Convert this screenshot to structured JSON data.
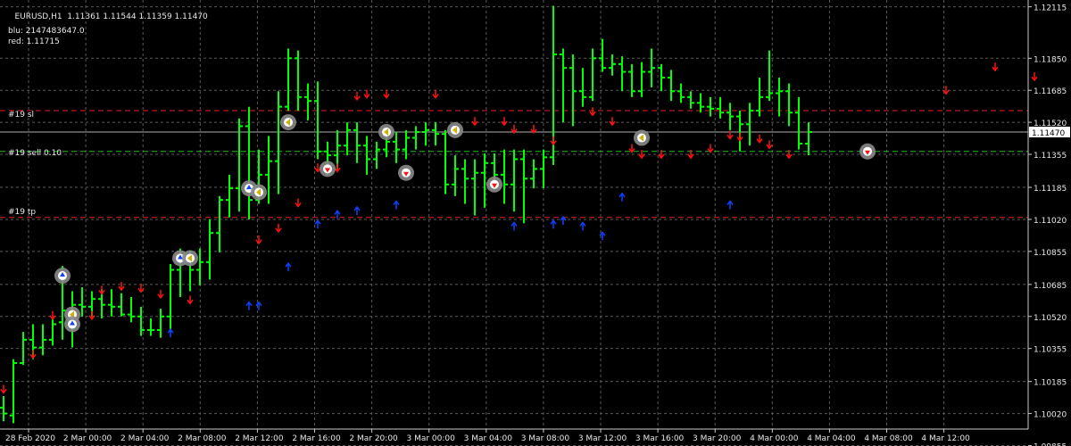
{
  "header": {
    "symbol": "EURUSD,H1",
    "ohlc": "1.11361 1.11544 1.11359 1.11470"
  },
  "indicator": {
    "blu": "blu: 2147483647.0",
    "red": "red: 1.11715"
  },
  "levels": {
    "sl": {
      "label": "#19 sl",
      "price": 1.1158,
      "color": "#e02020"
    },
    "sell": {
      "label": "#19 sell 0.10",
      "price": 1.1137,
      "color": "#20c020"
    },
    "tp": {
      "label": "#19 tp",
      "price": 1.1103,
      "color": "#e02020"
    }
  },
  "current_price": {
    "label": "1.11470",
    "value": 1.1147
  },
  "colors": {
    "background": "#000000",
    "grid": "#5a5a5a",
    "bar": "#00ff00",
    "up_arrow": "#1040ff",
    "down_arrow": "#ff1010",
    "text": "#e8e8e8"
  },
  "chart_data": {
    "type": "ohlc",
    "ylim": [
      1.0994,
      1.1215
    ],
    "grid": true,
    "y_ticks": [
      "1.12115",
      "1.11850",
      "1.11685",
      "1.11520",
      "1.11355",
      "1.11185",
      "1.11020",
      "1.10855",
      "1.10685",
      "1.10520",
      "1.10355",
      "1.10185",
      "1.10020",
      "1.09855"
    ],
    "y_tick_values": [
      1.12115,
      1.1185,
      1.11685,
      1.1152,
      1.11355,
      1.11185,
      1.1102,
      1.10855,
      1.10685,
      1.1052,
      1.10355,
      1.10185,
      1.1002,
      1.09855
    ],
    "x_ticks": [
      "28 Feb 2020",
      "2 Mar 00:00",
      "2 Mar 04:00",
      "2 Mar 08:00",
      "2 Mar 12:00",
      "2 Mar 16:00",
      "2 Mar 20:00",
      "3 Mar 00:00",
      "3 Mar 04:00",
      "3 Mar 08:00",
      "3 Mar 12:00",
      "3 Mar 16:00",
      "3 Mar 20:00",
      "4 Mar 00:00",
      "4 Mar 04:00",
      "4 Mar 08:00",
      "4 Mar 12:00"
    ],
    "bars": [
      [
        1.1005,
        1.1011,
        1.0998,
        1.1002
      ],
      [
        1.1001,
        1.103,
        1.0997,
        1.1028
      ],
      [
        1.1028,
        1.1044,
        1.1027,
        1.104
      ],
      [
        1.104,
        1.1048,
        1.103,
        1.1036
      ],
      [
        1.1036,
        1.1048,
        1.1032,
        1.104
      ],
      [
        1.104,
        1.1051,
        1.1037,
        1.1048
      ],
      [
        1.1049,
        1.1078,
        1.104,
        1.1055
      ],
      [
        1.1054,
        1.1065,
        1.1036,
        1.1058
      ],
      [
        1.1058,
        1.1067,
        1.1052,
        1.1057
      ],
      [
        1.1057,
        1.1065,
        1.1052,
        1.1061
      ],
      [
        1.1061,
        1.1066,
        1.1051,
        1.1058
      ],
      [
        1.1058,
        1.1066,
        1.1052,
        1.1057
      ],
      [
        1.1057,
        1.1064,
        1.1052,
        1.1053
      ],
      [
        1.1053,
        1.1062,
        1.1049,
        1.1052
      ],
      [
        1.1052,
        1.1057,
        1.1042,
        1.1045
      ],
      [
        1.1045,
        1.1051,
        1.1042,
        1.1045
      ],
      [
        1.1045,
        1.1056,
        1.1041,
        1.1052
      ],
      [
        1.1052,
        1.1079,
        1.1044,
        1.1076
      ],
      [
        1.1076,
        1.1087,
        1.1062,
        1.1082
      ],
      [
        1.1082,
        1.1086,
        1.1065,
        1.1076
      ],
      [
        1.1076,
        1.1087,
        1.1068,
        1.108
      ],
      [
        1.108,
        1.1102,
        1.1071,
        1.1095
      ],
      [
        1.1095,
        1.1114,
        1.1085,
        1.1112
      ],
      [
        1.1112,
        1.1125,
        1.1103,
        1.1118
      ],
      [
        1.1118,
        1.1154,
        1.1106,
        1.115
      ],
      [
        1.115,
        1.116,
        1.1102,
        1.1112
      ],
      [
        1.1112,
        1.1138,
        1.111,
        1.1125
      ],
      [
        1.1125,
        1.1145,
        1.111,
        1.1132
      ],
      [
        1.1132,
        1.1168,
        1.1115,
        1.116
      ],
      [
        1.116,
        1.119,
        1.1158,
        1.1185
      ],
      [
        1.1185,
        1.1189,
        1.1158,
        1.1165
      ],
      [
        1.1165,
        1.1172,
        1.1153,
        1.1163
      ],
      [
        1.1163,
        1.1173,
        1.1133,
        1.1137
      ],
      [
        1.1137,
        1.1142,
        1.1125,
        1.1135
      ],
      [
        1.1135,
        1.1148,
        1.1128,
        1.114
      ],
      [
        1.114,
        1.1152,
        1.1135,
        1.1148
      ],
      [
        1.1148,
        1.1152,
        1.1131,
        1.114
      ],
      [
        1.114,
        1.1145,
        1.1125,
        1.1133
      ],
      [
        1.1133,
        1.1142,
        1.1128,
        1.1138
      ],
      [
        1.1138,
        1.1146,
        1.1134,
        1.1142
      ],
      [
        1.1142,
        1.1147,
        1.1131,
        1.1138
      ],
      [
        1.1138,
        1.1148,
        1.1133,
        1.1144
      ],
      [
        1.1144,
        1.115,
        1.1138,
        1.1147
      ],
      [
        1.1147,
        1.1152,
        1.114,
        1.1148
      ],
      [
        1.1148,
        1.1152,
        1.114,
        1.1146
      ],
      [
        1.1146,
        1.1148,
        1.1115,
        1.112
      ],
      [
        1.112,
        1.1135,
        1.1114,
        1.1128
      ],
      [
        1.1128,
        1.1133,
        1.111,
        1.1123
      ],
      [
        1.1123,
        1.1133,
        1.1104,
        1.1126
      ],
      [
        1.1126,
        1.1136,
        1.1108,
        1.1131
      ],
      [
        1.1131,
        1.1136,
        1.1118,
        1.1125
      ],
      [
        1.1125,
        1.1138,
        1.111,
        1.112
      ],
      [
        1.112,
        1.1138,
        1.1106,
        1.1133
      ],
      [
        1.1133,
        1.1138,
        1.11,
        1.1123
      ],
      [
        1.1123,
        1.1133,
        1.1118,
        1.1128
      ],
      [
        1.1128,
        1.1138,
        1.1118,
        1.1134
      ],
      [
        1.1134,
        1.1212,
        1.113,
        1.1187
      ],
      [
        1.1187,
        1.119,
        1.1152,
        1.118
      ],
      [
        1.118,
        1.1187,
        1.115,
        1.1168
      ],
      [
        1.1168,
        1.118,
        1.116,
        1.1165
      ],
      [
        1.1165,
        1.119,
        1.1163,
        1.1185
      ],
      [
        1.1185,
        1.1195,
        1.1178,
        1.118
      ],
      [
        1.118,
        1.1187,
        1.1176,
        1.1182
      ],
      [
        1.1182,
        1.1186,
        1.1168,
        1.1178
      ],
      [
        1.1178,
        1.1182,
        1.1165,
        1.1168
      ],
      [
        1.1168,
        1.1183,
        1.1165,
        1.1178
      ],
      [
        1.1178,
        1.119,
        1.117,
        1.118
      ],
      [
        1.118,
        1.1182,
        1.1168,
        1.1175
      ],
      [
        1.1175,
        1.1179,
        1.1163,
        1.1168
      ],
      [
        1.1168,
        1.1172,
        1.1162,
        1.1165
      ],
      [
        1.1165,
        1.1168,
        1.1159,
        1.1162
      ],
      [
        1.1162,
        1.1167,
        1.1157,
        1.116
      ],
      [
        1.116,
        1.1165,
        1.1155,
        1.1159
      ],
      [
        1.1159,
        1.1165,
        1.1154,
        1.1157
      ],
      [
        1.1157,
        1.1162,
        1.1148,
        1.1155
      ],
      [
        1.1155,
        1.1158,
        1.1137,
        1.1151
      ],
      [
        1.1151,
        1.1162,
        1.114,
        1.1158
      ],
      [
        1.1158,
        1.1175,
        1.1155,
        1.1165
      ],
      [
        1.1165,
        1.1189,
        1.1163,
        1.1167
      ],
      [
        1.1167,
        1.1175,
        1.1155,
        1.1168
      ],
      [
        1.1168,
        1.1172,
        1.115,
        1.1157
      ],
      [
        1.1157,
        1.1165,
        1.1138,
        1.1141
      ],
      [
        1.1141,
        1.1152,
        1.1135,
        1.1147
      ]
    ],
    "up_arrows": [
      [
        17,
        1.1044
      ],
      [
        25,
        1.1058
      ],
      [
        26,
        1.1058
      ],
      [
        29,
        1.1078
      ],
      [
        32,
        1.11
      ],
      [
        34,
        1.1105
      ],
      [
        36,
        1.1107
      ],
      [
        40,
        1.111
      ],
      [
        52,
        1.1099
      ],
      [
        56,
        1.11
      ],
      [
        57,
        1.1102
      ],
      [
        59,
        1.1099
      ],
      [
        61,
        1.1094
      ],
      [
        63,
        1.1114
      ],
      [
        74,
        1.111
      ]
    ],
    "down_arrows": [
      [
        0,
        1.1014
      ],
      [
        3,
        1.1032
      ],
      [
        5,
        1.1052
      ],
      [
        7,
        1.1052
      ],
      [
        9,
        1.1052
      ],
      [
        10,
        1.1065
      ],
      [
        12,
        1.1067
      ],
      [
        14,
        1.1066
      ],
      [
        16,
        1.1063
      ],
      [
        19,
        1.106
      ],
      [
        26,
        1.1091
      ],
      [
        28,
        1.1097
      ],
      [
        30,
        1.111
      ],
      [
        32,
        1.1128
      ],
      [
        34,
        1.1128
      ],
      [
        36,
        1.1165
      ],
      [
        37,
        1.1166
      ],
      [
        39,
        1.1166
      ],
      [
        44,
        1.1166
      ],
      [
        48,
        1.1152
      ],
      [
        51,
        1.1152
      ],
      [
        52,
        1.1148
      ],
      [
        54,
        1.1148
      ],
      [
        56,
        1.1142
      ],
      [
        60,
        1.1157
      ],
      [
        62,
        1.1152
      ],
      [
        64,
        1.1138
      ],
      [
        65,
        1.1135
      ],
      [
        67,
        1.1135
      ],
      [
        70,
        1.1135
      ],
      [
        72,
        1.1138
      ],
      [
        74,
        1.1145
      ],
      [
        75,
        1.1144
      ],
      [
        77,
        1.1143
      ],
      [
        78,
        1.114
      ],
      [
        80,
        1.1135
      ],
      [
        96,
        1.1168
      ],
      [
        101,
        1.118
      ],
      [
        105,
        1.1175
      ]
    ],
    "markers": [
      {
        "i": 6,
        "p": 1.1073,
        "kind": "buy"
      },
      {
        "i": 7,
        "p": 1.1053,
        "kind": "close"
      },
      {
        "i": 7,
        "p": 1.1048,
        "kind": "buy"
      },
      {
        "i": 18,
        "p": 1.1082,
        "kind": "buy"
      },
      {
        "i": 19,
        "p": 1.1082,
        "kind": "close"
      },
      {
        "i": 25,
        "p": 1.1118,
        "kind": "buy"
      },
      {
        "i": 26,
        "p": 1.1116,
        "kind": "close"
      },
      {
        "i": 29,
        "p": 1.1152,
        "kind": "close"
      },
      {
        "i": 33,
        "p": 1.1128,
        "kind": "sell"
      },
      {
        "i": 39,
        "p": 1.1147,
        "kind": "close"
      },
      {
        "i": 41,
        "p": 1.1126,
        "kind": "sell"
      },
      {
        "i": 46,
        "p": 1.1148,
        "kind": "close"
      },
      {
        "i": 50,
        "p": 1.112,
        "kind": "sell"
      },
      {
        "i": 65,
        "p": 1.1144,
        "kind": "close"
      },
      {
        "i": 88,
        "p": 1.1137,
        "kind": "sell"
      }
    ]
  }
}
